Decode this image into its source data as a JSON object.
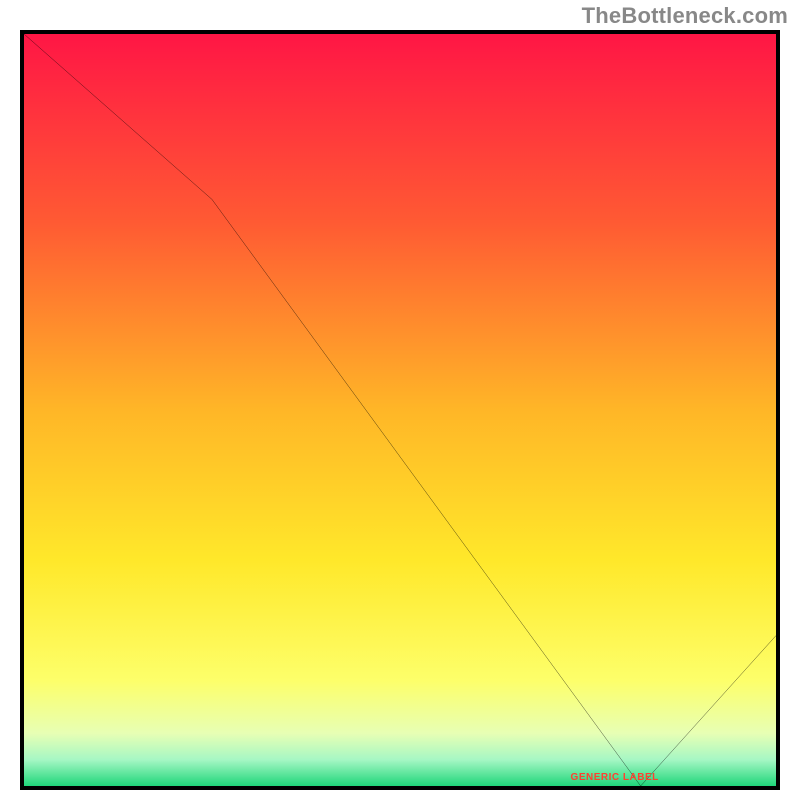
{
  "watermark": "TheBottleneck.com",
  "chart_data": {
    "type": "line",
    "title": "",
    "xlabel": "",
    "ylabel": "",
    "xlim": [
      0,
      100
    ],
    "ylim": [
      0,
      100
    ],
    "grid": false,
    "series": [
      {
        "name": "bottleneck-curve",
        "x": [
          0,
          25,
          82,
          100
        ],
        "values": [
          100,
          78,
          0,
          20
        ]
      }
    ],
    "annotations": [
      {
        "name": "baseline-label",
        "text": "GENERIC LABEL",
        "x": 78,
        "y": 1
      }
    ],
    "background_gradient_stops": [
      {
        "offset": 0.0,
        "color": "#ff1645"
      },
      {
        "offset": 0.25,
        "color": "#ff5a33"
      },
      {
        "offset": 0.5,
        "color": "#ffb627"
      },
      {
        "offset": 0.7,
        "color": "#ffe82a"
      },
      {
        "offset": 0.86,
        "color": "#fdff6a"
      },
      {
        "offset": 0.93,
        "color": "#e7ffb4"
      },
      {
        "offset": 0.965,
        "color": "#a6f7c4"
      },
      {
        "offset": 1.0,
        "color": "#1fd67a"
      }
    ]
  }
}
